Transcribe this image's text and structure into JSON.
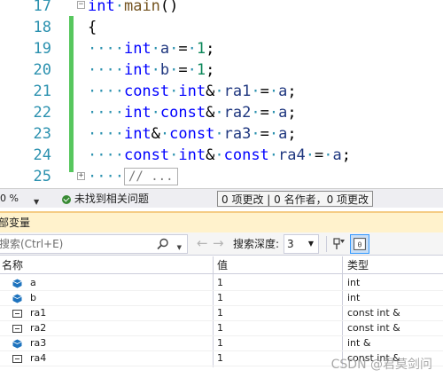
{
  "editor": {
    "lines": [
      {
        "num": "17"
      },
      {
        "num": "18"
      },
      {
        "num": "19"
      },
      {
        "num": "20"
      },
      {
        "num": "21"
      },
      {
        "num": "22"
      },
      {
        "num": "23"
      },
      {
        "num": "24"
      },
      {
        "num": "25"
      }
    ],
    "code": {
      "l17_kw": "int",
      "l17_fn": "main",
      "l17_paren": "()",
      "brace": "{",
      "indent": "····",
      "dot": "·",
      "int": "int",
      "const": "const",
      "amp": "&",
      "eq": "=",
      "semi": ";",
      "one": "1",
      "a": "a",
      "b": "b",
      "ra1": "ra1",
      "ra2": "ra2",
      "ra3": "ra3",
      "ra4": "ra4",
      "collapsed": "// ..."
    },
    "accent_green": "#57c75e"
  },
  "status": {
    "zoom": "0 %",
    "issues": "未找到相关问题",
    "git": "0 项更改 | 0 名作者，0 项更改"
  },
  "locals": {
    "title": "部变量",
    "search_placeholder": "搜索(Ctrl+E)",
    "depth_label": "搜索深度:",
    "depth_value": "3",
    "columns": {
      "name": "名称",
      "value": "值",
      "type": "类型"
    },
    "rows": [
      {
        "name": "a",
        "value": "1",
        "type": "int",
        "icon": "variable-icon"
      },
      {
        "name": "b",
        "value": "1",
        "type": "int",
        "icon": "variable-icon"
      },
      {
        "name": "ra1",
        "value": "1",
        "type": "const int &",
        "icon": "reference-icon"
      },
      {
        "name": "ra2",
        "value": "1",
        "type": "const int &",
        "icon": "reference-icon"
      },
      {
        "name": "ra3",
        "value": "1",
        "type": "int &",
        "icon": "variable-icon"
      },
      {
        "name": "ra4",
        "value": "1",
        "type": "const int &",
        "icon": "reference-icon"
      }
    ]
  },
  "watermark": "CSDN @君莫剑问"
}
